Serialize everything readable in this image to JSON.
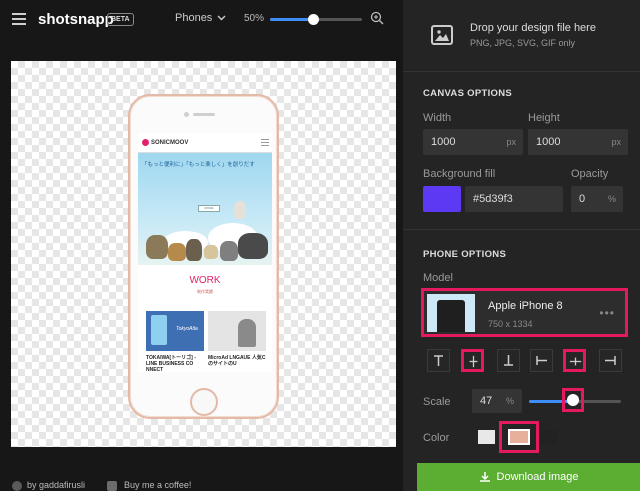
{
  "header": {
    "logo": "shotsnapp",
    "badge": "BETA",
    "device_select": "Phones",
    "zoom_label": "50%",
    "zoom_level": 0.47
  },
  "mockup": {
    "brand": "SONICMOOV",
    "hero_heading": "「もっと便利に」「もっと楽しく」を創りだす",
    "hero_button": "MORE",
    "section_title": "WORK",
    "section_sub": "制作実績",
    "card1_logo": "TokyoAtla",
    "card1_caption": "TOKAIWA[トーリゴ] - LINE BUSINESS CO NNECT",
    "card2_caption": "MicroAd LNGAUE 人気CのサイトのU"
  },
  "footer": {
    "author": "by gaddafirusli",
    "coffee": "Buy me a coffee!"
  },
  "panel": {
    "drop_title": "Drop your design file here",
    "drop_sub": "PNG, JPG, SVG, GIF only",
    "canvas_title": "CANVAS OPTIONS",
    "width_label": "Width",
    "width_value": "1000",
    "height_label": "Height",
    "height_value": "1000",
    "unit_px": "px",
    "bg_label": "Background fill",
    "bg_value": "#5d39f3",
    "opacity_label": "Opacity",
    "opacity_value": "0",
    "unit_pct": "%",
    "phone_title": "PHONE OPTIONS",
    "model_label": "Model",
    "model_name": "Apple iPhone 8",
    "model_res": "750 x 1334",
    "model_more": "•••",
    "scale_label": "Scale",
    "scale_value": "47",
    "scale_level": 0.47,
    "color_label": "Color",
    "colors": [
      "#e8e8e8",
      "#e7b09a",
      "#222222"
    ],
    "selected_color": 1,
    "download_label": "Download image"
  },
  "colors": {
    "accent": "#3d8ef8",
    "highlight": "#e5195e",
    "download": "#5cae33"
  }
}
